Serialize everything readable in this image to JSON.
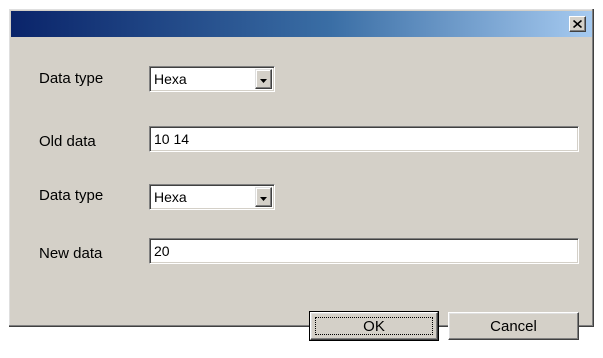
{
  "dialog": {
    "title": "",
    "close_icon": "close-icon"
  },
  "form": {
    "data_type_1": {
      "label": "Data type",
      "selected": "Hexa"
    },
    "old_data": {
      "label": "Old data",
      "value": "10 14"
    },
    "data_type_2": {
      "label": "Data type",
      "selected": "Hexa"
    },
    "new_data": {
      "label": "New data",
      "value": "20"
    }
  },
  "buttons": {
    "ok_label": "OK",
    "cancel_label": "Cancel"
  },
  "colors": {
    "title_gradient_start": "#0a246a",
    "title_gradient_end": "#a6caf0",
    "face": "#d4d0c8"
  }
}
